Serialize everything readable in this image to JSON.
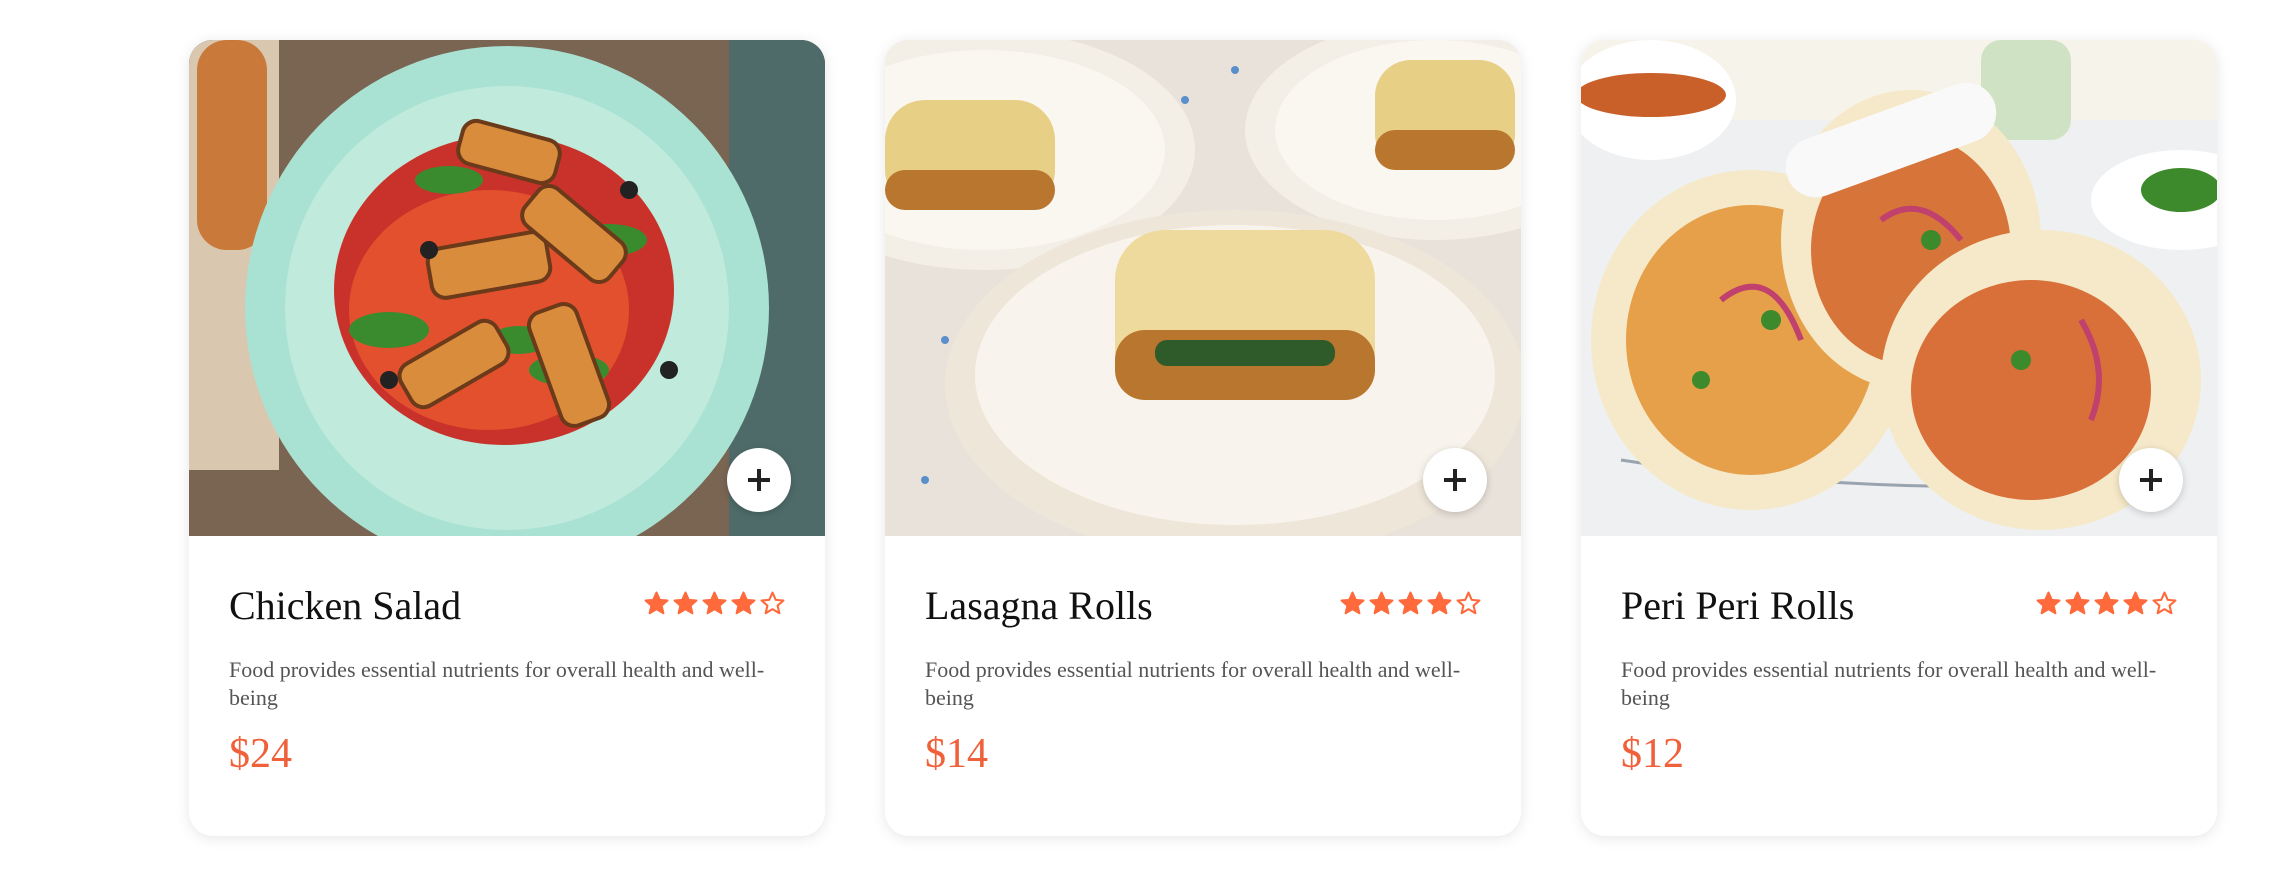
{
  "colors": {
    "accent": "#f0603a",
    "star": "#ff6a3d"
  },
  "cards": [
    {
      "title": "Chicken Salad",
      "rating": 4,
      "rating_max": 5,
      "description": "Food provides essential nutrients for overall health and well-being",
      "price": "$24",
      "add_label": "+",
      "image_icon": "salad-photo"
    },
    {
      "title": "Lasagna Rolls",
      "rating": 4,
      "rating_max": 5,
      "description": "Food provides essential nutrients for overall health and well-being",
      "price": "$14",
      "add_label": "+",
      "image_icon": "lasagna-photo"
    },
    {
      "title": "Peri Peri Rolls",
      "rating": 4,
      "rating_max": 5,
      "description": "Food provides essential nutrients for overall health and well-being",
      "price": "$12",
      "add_label": "+",
      "image_icon": "wrap-photo"
    }
  ]
}
